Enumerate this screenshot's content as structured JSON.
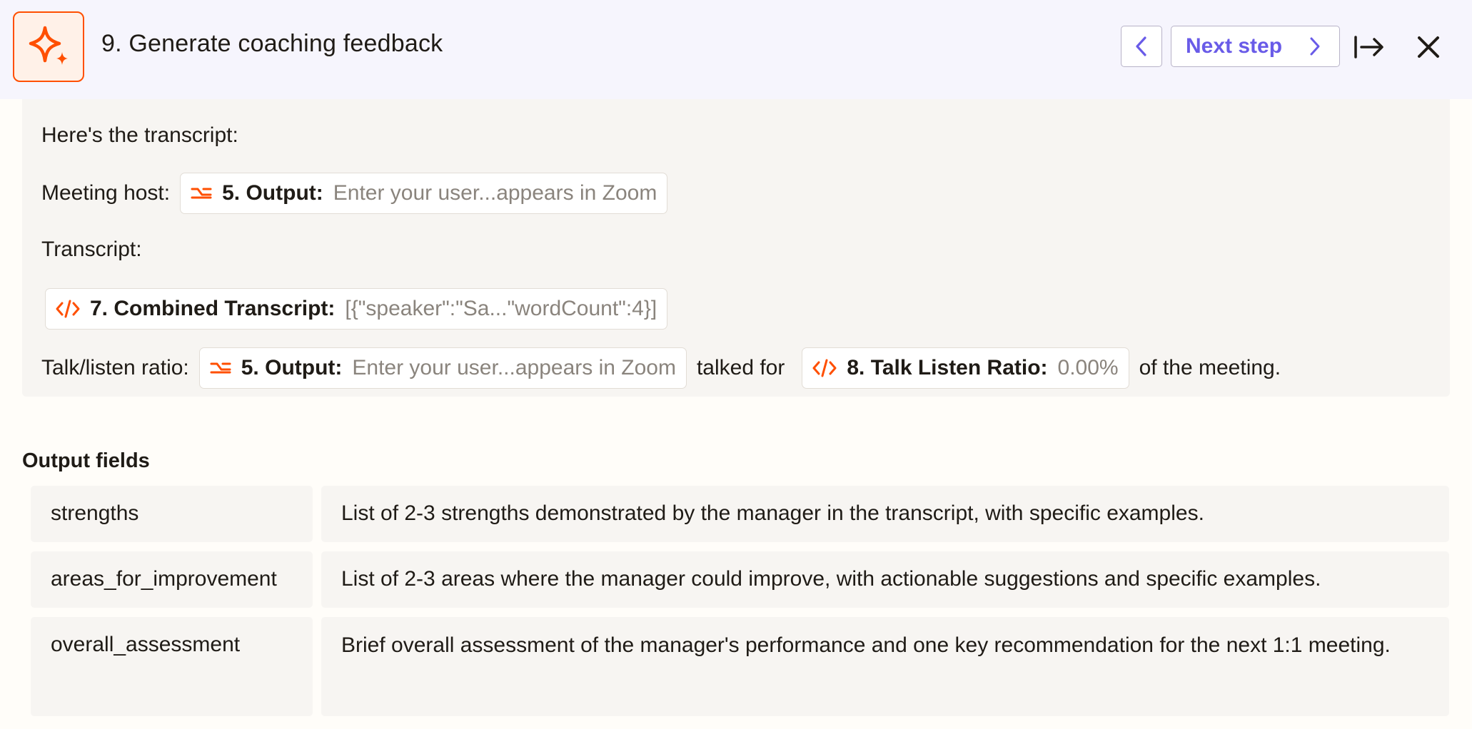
{
  "header": {
    "step_title": "9. Generate coaching feedback",
    "next_label": "Next step",
    "app_icon": "ai-sparkle-icon",
    "colors": {
      "accent": "#ff4f00",
      "nav": "#695be8",
      "header_bg": "#f6f5fd"
    }
  },
  "prompt": {
    "intro": "Here's the transcript:",
    "host_label": "Meeting host:",
    "host_pill": {
      "label": "5. Output:",
      "value": "Enter your user...appears in Zoom",
      "icon": "formatter-icon"
    },
    "transcript_label": "Transcript:",
    "transcript_pill": {
      "label": "7. Combined Transcript:",
      "value": "[{\"speaker\":\"Sa...\"wordCount\":4}]",
      "icon": "code-icon"
    },
    "ratio_label": "Talk/listen ratio:",
    "ratio_pill_user": {
      "label": "5. Output:",
      "value": "Enter your user...appears in Zoom",
      "icon": "formatter-icon"
    },
    "talked_for": "talked for",
    "ratio_pill_value": {
      "label": "8. Talk Listen Ratio:",
      "value": "0.00%",
      "icon": "code-icon"
    },
    "of_meeting": "of the meeting."
  },
  "output_fields": {
    "heading": "Output fields",
    "rows": [
      {
        "name": "strengths",
        "description": "List of 2-3 strengths demonstrated by the manager in the transcript, with specific examples."
      },
      {
        "name": "areas_for_improvement",
        "description": "List of 2-3 areas where the manager could improve, with actionable suggestions and specific examples."
      },
      {
        "name": "overall_assessment",
        "description": "Brief overall assessment of the manager's performance and one key recommendation for the next 1:1 meeting."
      }
    ]
  }
}
